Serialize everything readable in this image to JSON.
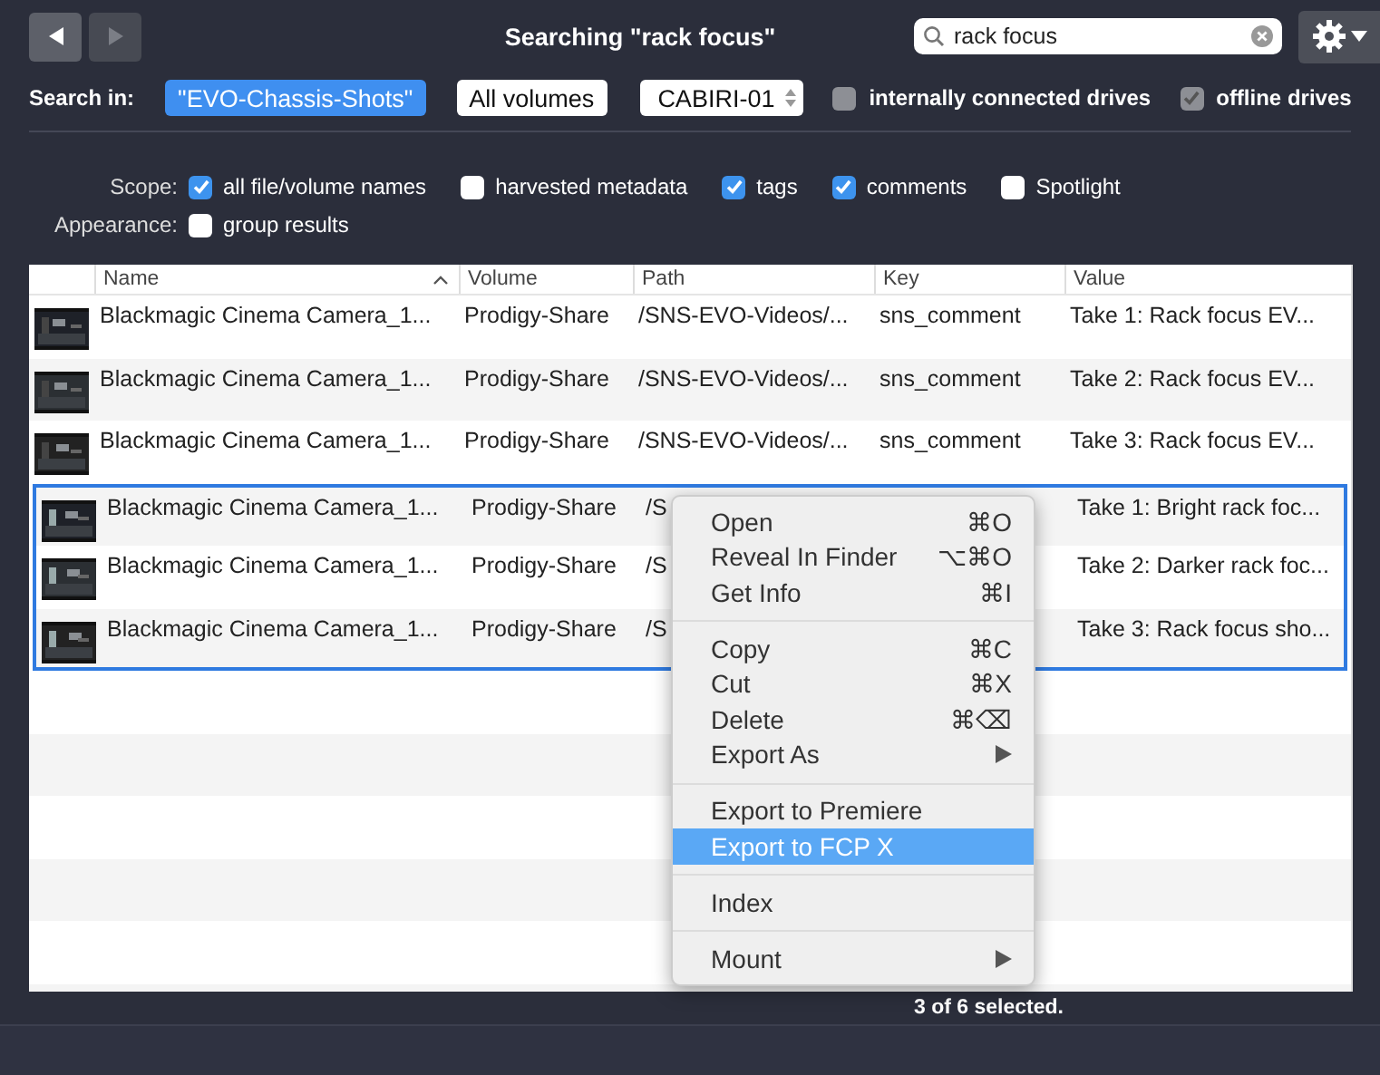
{
  "toolbar": {
    "back_button": {
      "disabled": false
    },
    "forward_button": {
      "disabled": true
    },
    "title": "Searching \"rack focus\"",
    "search": {
      "value": "rack focus"
    }
  },
  "search_in": {
    "label": "Search in:",
    "options": [
      {
        "label": "\"EVO-Chassis-Shots\"",
        "selected": true
      },
      {
        "label": "All volumes",
        "selected": false
      }
    ],
    "popup": {
      "value": "CABIRI-01"
    },
    "checkboxes": [
      {
        "label": "internally connected drives",
        "checked": false,
        "disabled": true
      },
      {
        "label": "offline drives",
        "checked": true,
        "disabled": true
      }
    ]
  },
  "scope": {
    "label": "Scope:",
    "checkboxes": [
      {
        "label": "all file/volume names",
        "checked": true
      },
      {
        "label": "harvested metadata",
        "checked": false
      },
      {
        "label": "tags",
        "checked": true
      },
      {
        "label": "comments",
        "checked": true
      },
      {
        "label": "Spotlight",
        "checked": false
      }
    ]
  },
  "appearance": {
    "label": "Appearance:",
    "checkboxes": [
      {
        "label": "group results",
        "checked": false
      }
    ]
  },
  "table": {
    "columns": [
      {
        "label": "Name",
        "sorted": true
      },
      {
        "label": "Volume",
        "sorted": false
      },
      {
        "label": "Path",
        "sorted": false
      },
      {
        "label": "Key",
        "sorted": false
      },
      {
        "label": "Value",
        "sorted": false
      }
    ],
    "rows": [
      {
        "name": "Blackmagic Cinema Camera_1...",
        "volume": "Prodigy-Share",
        "path": "/SNS-EVO-Videos/...",
        "key": "sns_comment",
        "value": "Take 1: Rack focus EV...",
        "selected": false
      },
      {
        "name": "Blackmagic Cinema Camera_1...",
        "volume": "Prodigy-Share",
        "path": "/SNS-EVO-Videos/...",
        "key": "sns_comment",
        "value": "Take 2: Rack focus EV...",
        "selected": false
      },
      {
        "name": "Blackmagic Cinema Camera_1...",
        "volume": "Prodigy-Share",
        "path": "/SNS-EVO-Videos/...",
        "key": "sns_comment",
        "value": "Take 3: Rack focus EV...",
        "selected": false
      },
      {
        "name": "Blackmagic Cinema Camera_1...",
        "volume": "Prodigy-Share",
        "path": "/S",
        "value": "Take 1: Bright rack foc...",
        "selected": true
      },
      {
        "name": "Blackmagic Cinema Camera_1...",
        "volume": "Prodigy-Share",
        "path": "/S",
        "value": "Take 2: Darker rack foc...",
        "selected": true
      },
      {
        "name": "Blackmagic Cinema Camera_1...",
        "volume": "Prodigy-Share",
        "path": "/S",
        "value": "Take 3: Rack focus sho...",
        "selected": true
      }
    ]
  },
  "context_menu": {
    "items": [
      {
        "kind": "item",
        "label": "Open",
        "shortcut": "⌘O",
        "selected": false
      },
      {
        "kind": "item",
        "label": "Reveal In Finder",
        "shortcut": "⌥⌘O",
        "selected": false
      },
      {
        "kind": "item",
        "label": "Get Info",
        "shortcut": "⌘I",
        "selected": false
      },
      {
        "kind": "separator"
      },
      {
        "kind": "item",
        "label": "Copy",
        "shortcut": "⌘C",
        "selected": false
      },
      {
        "kind": "item",
        "label": "Cut",
        "shortcut": "⌘X",
        "selected": false
      },
      {
        "kind": "item",
        "label": "Delete",
        "shortcut": "⌘⌫",
        "selected": false
      },
      {
        "kind": "submenu",
        "label": "Export As",
        "selected": false
      },
      {
        "kind": "separator"
      },
      {
        "kind": "item",
        "label": "Export to Premiere",
        "selected": false
      },
      {
        "kind": "item",
        "label": "Export to FCP X",
        "selected": true
      },
      {
        "kind": "separator"
      },
      {
        "kind": "item",
        "label": "Index",
        "selected": false
      },
      {
        "kind": "separator"
      },
      {
        "kind": "submenu",
        "label": "Mount",
        "selected": false
      }
    ]
  },
  "status_bar": {
    "text": "3 of 6 selected."
  }
}
